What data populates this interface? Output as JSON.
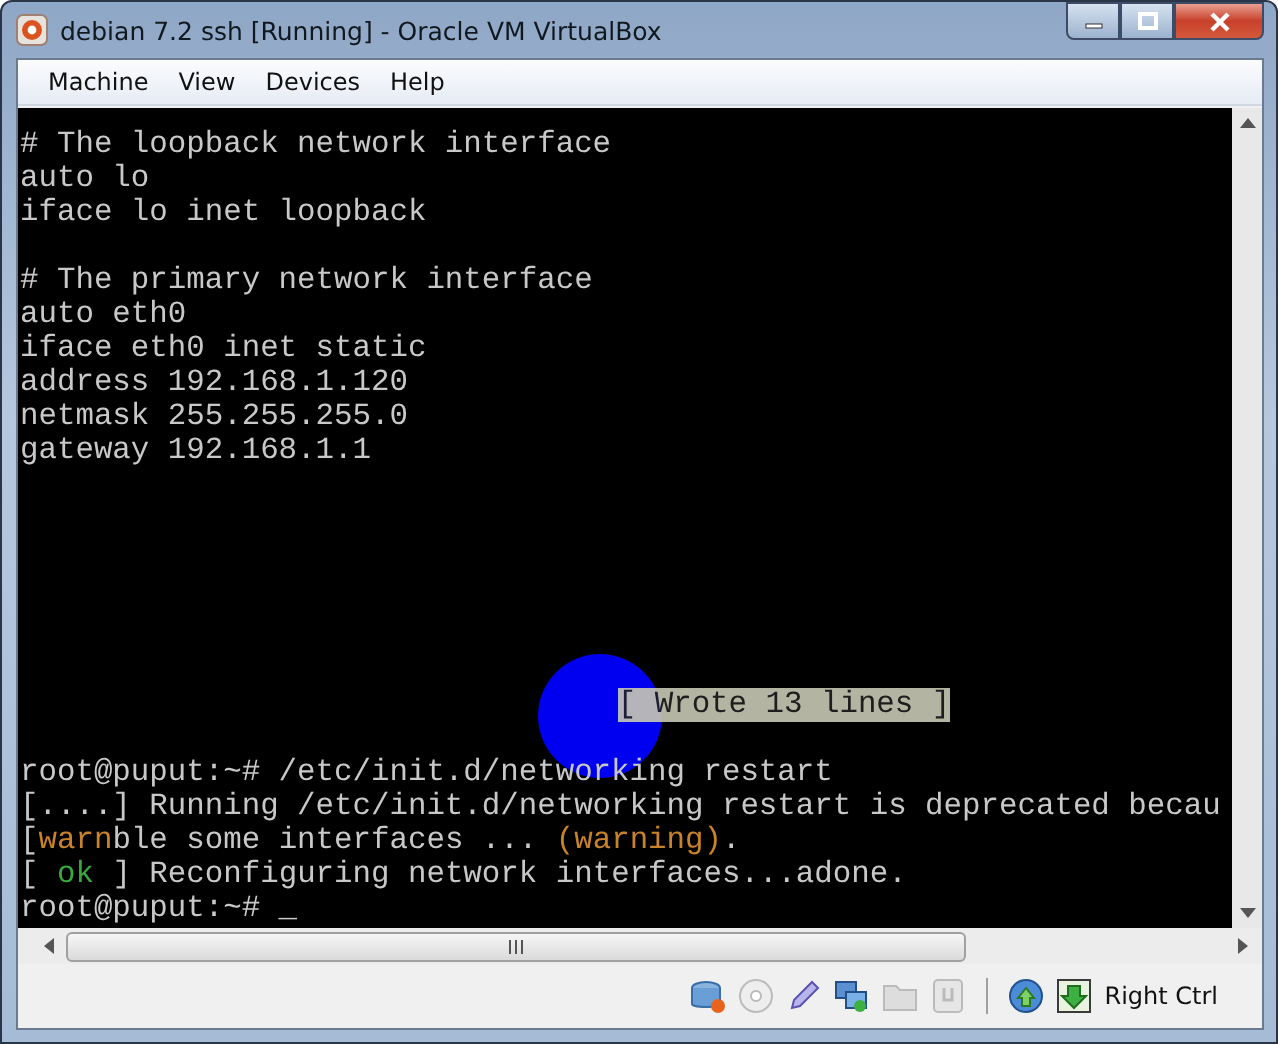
{
  "window": {
    "title": "debian 7.2 ssh [Running] - Oracle VM VirtualBox"
  },
  "menu": [
    "Machine",
    "View",
    "Devices",
    "Help"
  ],
  "terminal": {
    "top_blocks": [
      [
        [
          {
            "kind": "plain",
            "text": "# The loopback network interface"
          }
        ],
        [
          {
            "kind": "plain",
            "text": "auto lo"
          }
        ],
        [
          {
            "kind": "plain",
            "text": "iface lo inet loopback"
          }
        ]
      ],
      [
        [
          {
            "kind": "plain",
            "text": "# The primary network interface"
          }
        ],
        [
          {
            "kind": "plain",
            "text": "auto eth0"
          }
        ],
        [
          {
            "kind": "plain",
            "text": "iface eth0 inet static"
          }
        ],
        [
          {
            "kind": "plain",
            "text": "address 192.168.1.120"
          }
        ],
        [
          {
            "kind": "plain",
            "text": "netmask 255.255.255.0"
          }
        ],
        [
          {
            "kind": "plain",
            "text": "gateway 192.168.1.1"
          }
        ]
      ]
    ],
    "message": "[ Wrote 13 lines ]",
    "bottom_lines": [
      [
        {
          "kind": "plain",
          "text": "root@puput:~# /etc/init.d/networking restart"
        }
      ],
      [
        {
          "kind": "plain",
          "text": "[....] Running /etc/init.d/networking restart is deprecated becau"
        }
      ],
      [
        {
          "kind": "plain",
          "text": "["
        },
        {
          "kind": "warn",
          "text": "warn"
        },
        {
          "kind": "plain",
          "text": "ble some interfaces ... "
        },
        {
          "kind": "warn",
          "text": "(warning)"
        },
        {
          "kind": "plain",
          "text": "."
        }
      ],
      [
        {
          "kind": "plain",
          "text": "[ "
        },
        {
          "kind": "ok",
          "text": "ok"
        },
        {
          "kind": "plain",
          "text": " ] Reconfiguring network interfaces...adone."
        }
      ],
      [
        {
          "kind": "plain",
          "text": "root@puput:~# _"
        }
      ]
    ]
  },
  "status_bar": {
    "host_key": "Right Ctrl"
  }
}
